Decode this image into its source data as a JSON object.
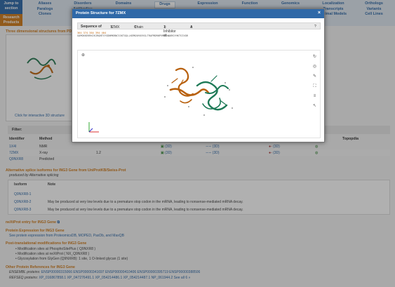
{
  "nav": {
    "jump": "Jump to section",
    "research": "Research Products",
    "columns": [
      {
        "items": [
          "Aliases",
          "Paralogs",
          "Clones"
        ]
      },
      {
        "items": [
          "Disorders",
          "Antibodies"
        ]
      },
      {
        "items": [
          "Domains"
        ]
      },
      {
        "items": [
          "Drugs"
        ]
      },
      {
        "items": [
          "Expression"
        ]
      },
      {
        "items": [
          "Function"
        ]
      },
      {
        "items": [
          "Genomics"
        ]
      },
      {
        "items": [
          "Localization",
          "Transcripts",
          "Animal Models"
        ]
      },
      {
        "items": [
          "Orthologs",
          "Variants",
          "Cell Lines"
        ]
      }
    ]
  },
  "structures": {
    "title": "Three dimensional structures from PDB",
    "click_link": "Click for interactive 3D structure",
    "filter_label": "Filter:",
    "headers": [
      "Identifier",
      "Method",
      "",
      "",
      "",
      "",
      "Topopdia"
    ],
    "rows": [
      {
        "id": "1X4I",
        "method": "NMR",
        "res": "",
        "col3": "(3D)",
        "col4": "(3D)",
        "col5": "(3D)"
      },
      {
        "id": "7ZMX",
        "method": "X-ray",
        "res": "1.2",
        "col3": "(3D)",
        "col4": "(3D)",
        "col5": "(3D)"
      },
      {
        "id": "Q9NXR8",
        "method": "Predicted",
        "res": "",
        "col3": "",
        "col4": "",
        "col5": ""
      }
    ]
  },
  "isoforms": {
    "title": "Alternative splice isoforms for ING3 Gene from UniProtKB/Swiss-Prot",
    "produced_by": "produced by Alternative splicing",
    "header_isoform": "Isoform",
    "header_note": "Note",
    "rows": [
      {
        "id": "Q9NXR8-1",
        "note": ""
      },
      {
        "id": "Q9NXR8-2",
        "note": "May be produced at very low levels due to a premature stop codon in the mRNA, leading to nonsense-mediated mRNA decay."
      },
      {
        "id": "Q9NXR8-3",
        "note": "May be produced at very low levels due to a premature stop codon in the mRNA, leading to nonsense-mediated mRNA decay."
      }
    ]
  },
  "nextprot": {
    "title": "neXtProt entry for ING3 Gene"
  },
  "protein_expr": {
    "title": "Protein Expression for ING3 Gene",
    "text": "See protein expression from ProteomicsDB, MOPED, PaxDb, and MaxQB"
  },
  "ptm": {
    "title": "Post-translational modifications for ING3 Gene",
    "items": [
      "Modification sites at PhosphoSitePlus ( Q9NXR8 )",
      "Modification sites at neXtProt ( NX_Q9NXR8 )",
      "Glycosylation from GlyGen (Q9NXR8): 1 site, 1 O-linked glycan (1 site)"
    ]
  },
  "other_refs": {
    "title": "Other Protein References for ING3 Gene",
    "ensembl_label": "ENSEMBL proteins:",
    "ensembl": "ENSP00000315066  ENSP00000341697  ENSP00000410406  ENSP00000395719  ENSP00000388506",
    "refseq_label": "REFSEQ proteins:",
    "refseq": "XP_016867858.1  XP_047276491.1  XP_054214486.1  XP_054214487.1  NP_061944.2  See all 6 »"
  },
  "modal": {
    "title": "Protein Structure for 7ZMX",
    "close": "×",
    "sequence_label": "Sequence of",
    "pdb_select": "7ZMX",
    "chain_select": "Chain",
    "chain_desc": "1: Inhibitor of ...",
    "chain_id": "A",
    "help": "?",
    "ruler": "364          374          384          394          404",
    "sequence": "GAMGKKEKRKIKIRQNTSYSDNMKRNCSSKTGQLLKEMQVKKVVGLTRAFMDRNPVMAQHKKRGYHKTSIVQR"
  },
  "colors": {
    "nav_bg": "#dfe8f1",
    "brand_blue": "#2f69a8",
    "accent_orange": "#d07b1b",
    "chain_orange": "#b8610f",
    "chain_green": "#1e7a57"
  },
  "icons": [
    "refresh-icon",
    "target-icon",
    "wrench-icon",
    "expand-icon",
    "layers-icon",
    "pointer-icon",
    "lock-icon"
  ]
}
